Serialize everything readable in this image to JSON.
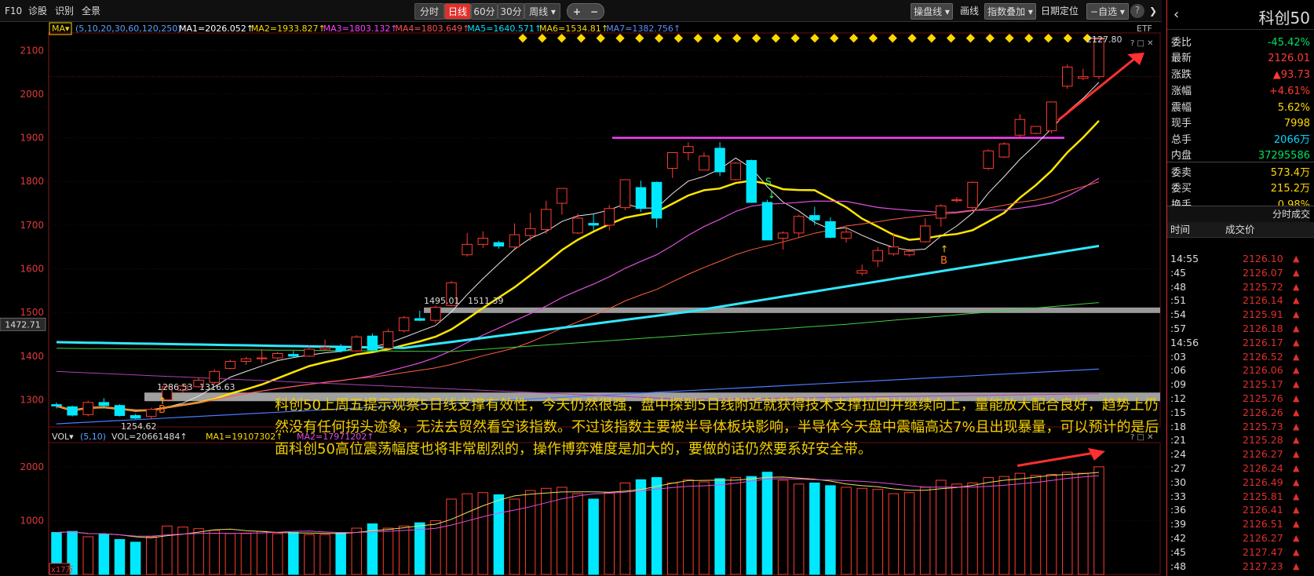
{
  "toolbar": {
    "left_tabs": [
      "F10",
      "诊股",
      "识别",
      "全景"
    ],
    "period_tabs": [
      {
        "label": "分时",
        "active": false
      },
      {
        "label": "日线",
        "active": true
      },
      {
        "label": "60分",
        "active": false
      },
      {
        "label": "30分",
        "active": false
      },
      {
        "label": "周线 ▾",
        "active": false
      }
    ],
    "zoom_in": "+",
    "zoom_out": "−",
    "right_tools": [
      {
        "label": "操盘线",
        "dropdown": true
      },
      {
        "label": "画线",
        "dropdown": false
      },
      {
        "label": "指数叠加",
        "dropdown": true
      },
      {
        "label": "日期定位",
        "dropdown": false
      },
      {
        "label": "−自选",
        "dropdown": true
      }
    ],
    "help": "?"
  },
  "ma_legend": {
    "tag": "MA▾",
    "params": "(5,10,20,30,60,120,250)",
    "items": [
      {
        "text": "MA1=2026.052↑",
        "color": "#ffffff"
      },
      {
        "text": "MA2=1933.827↑",
        "color": "#ffd700"
      },
      {
        "text": "MA3=1803.132↑",
        "color": "#ff40ff"
      },
      {
        "text": "MA4=1803.649↑",
        "color": "#ff5050"
      },
      {
        "text": "MA5=1640.571↑",
        "color": "#00e0ff"
      },
      {
        "text": "MA6=1534.81↑",
        "color": "#ffd700"
      },
      {
        "text": "MA7=1382.756↑",
        "color": "#5a8aff"
      }
    ]
  },
  "etf": "ETF",
  "price_axis": [
    "2100",
    "2000",
    "1900",
    "1800",
    "1700",
    "1600",
    "1500",
    "1400",
    "1300"
  ],
  "current_price_tag": "1472.71",
  "annotations": {
    "high": "2127.80",
    "level1a": "1495.01",
    "level1b": "1511.39",
    "level2a": "1286.53",
    "level2b": "1316.63",
    "low": "1254.62",
    "s_mark": "S",
    "b_mark1": "B",
    "b_mark2": "B"
  },
  "vol_legend": {
    "tag": "VOL▾",
    "params": "(5,10)",
    "vol": "VOL=20661484↑",
    "ma1": "MA1=19107302↑",
    "ma2": "MA2=17971202↑"
  },
  "vol_axis": [
    "2000",
    "1000"
  ],
  "vol_unit": "x17万",
  "caption": "科创50上周五提示观察5日线支撑有效性，今天仍然很强，盘中探到5日线附近就获得技术支撑拉回并继续向上，量能放大配合良好，趋势上仍然没有任何拐头迹象，无法去贸然看空该指数。不过该指数主要被半导体板块影响，半导体今天盘中震幅高达7%且出现暴量，可以预计的是后面科创50高位震荡幅度也将非常剧烈的，操作博弈难度是加大的，要做的话仍然要系好安全带。",
  "right_panel": {
    "title": "科创50",
    "quotes": [
      {
        "label": "委比",
        "value": "-45.42%",
        "color": "#00e060"
      },
      {
        "label": "最新",
        "value": "2126.01",
        "color": "#ff3b30"
      },
      {
        "label": "涨跌",
        "value": "▲93.73",
        "color": "#ff3b30"
      },
      {
        "label": "涨幅",
        "value": "+4.61%",
        "color": "#ff3b30"
      },
      {
        "label": "震幅",
        "value": "5.62%",
        "color": "#ffd700"
      },
      {
        "label": "现手",
        "value": "7998",
        "color": "#ffd700"
      },
      {
        "label": "总手",
        "value": "2066万",
        "color": "#00d8ff"
      },
      {
        "label": "内盘",
        "value": "37295586",
        "color": "#00e060"
      },
      {
        "label": "委卖",
        "value": "573.4万",
        "color": "#ffd700"
      },
      {
        "label": "委买",
        "value": "215.2万",
        "color": "#ffd700"
      },
      {
        "label": "换手",
        "value": "0.98%",
        "color": "#ffd700"
      }
    ],
    "ticks_title": "分时成交",
    "col_time": "时间",
    "col_price": "成交价",
    "ticks": [
      {
        "t": "14:55",
        "p": "2126.10"
      },
      {
        "t": ":45",
        "p": "2126.07"
      },
      {
        "t": ":48",
        "p": "2125.72"
      },
      {
        "t": ":51",
        "p": "2126.14"
      },
      {
        "t": ":54",
        "p": "2125.91"
      },
      {
        "t": ":57",
        "p": "2126.18"
      },
      {
        "t": "14:56",
        "p": "2126.17"
      },
      {
        "t": ":03",
        "p": "2126.52"
      },
      {
        "t": ":06",
        "p": "2126.06"
      },
      {
        "t": ":09",
        "p": "2125.17"
      },
      {
        "t": ":12",
        "p": "2125.76"
      },
      {
        "t": ":15",
        "p": "2126.26"
      },
      {
        "t": ":18",
        "p": "2125.73"
      },
      {
        "t": ":21",
        "p": "2125.28"
      },
      {
        "t": ":24",
        "p": "2126.27"
      },
      {
        "t": ":27",
        "p": "2126.24"
      },
      {
        "t": ":30",
        "p": "2126.49"
      },
      {
        "t": ":33",
        "p": "2125.81"
      },
      {
        "t": ":36",
        "p": "2126.41"
      },
      {
        "t": ":39",
        "p": "2126.51"
      },
      {
        "t": ":42",
        "p": "2126.27"
      },
      {
        "t": ":45",
        "p": "2127.47"
      },
      {
        "t": ":48",
        "p": "2127.23"
      }
    ]
  },
  "colors": {
    "up": "#ff3b30",
    "down": "#00e8ff",
    "bg": "#000000",
    "grid": "#3a1010"
  },
  "chart_data": {
    "type": "candlestick",
    "candles": [
      [
        1289,
        1294,
        1280,
        1286
      ],
      [
        1284,
        1287,
        1262,
        1265
      ],
      [
        1266,
        1298,
        1262,
        1294
      ],
      [
        1294,
        1304,
        1280,
        1287
      ],
      [
        1287,
        1290,
        1262,
        1264
      ],
      [
        1264,
        1268,
        1256,
        1258
      ],
      [
        1262,
        1282,
        1256,
        1278
      ],
      [
        1300,
        1334,
        1298,
        1330
      ],
      [
        1322,
        1336,
        1316,
        1332
      ],
      [
        1330,
        1350,
        1328,
        1345
      ],
      [
        1340,
        1370,
        1336,
        1365
      ],
      [
        1372,
        1392,
        1370,
        1388
      ],
      [
        1388,
        1398,
        1380,
        1394
      ],
      [
        1394,
        1416,
        1384,
        1396
      ],
      [
        1396,
        1410,
        1390,
        1406
      ],
      [
        1404,
        1412,
        1396,
        1400
      ],
      [
        1400,
        1424,
        1398,
        1416
      ],
      [
        1416,
        1438,
        1412,
        1420
      ],
      [
        1420,
        1428,
        1408,
        1412
      ],
      [
        1412,
        1448,
        1410,
        1444
      ],
      [
        1446,
        1452,
        1410,
        1414
      ],
      [
        1418,
        1462,
        1416,
        1456
      ],
      [
        1458,
        1492,
        1454,
        1488
      ],
      [
        1486,
        1504,
        1480,
        1482
      ],
      [
        1482,
        1516,
        1476,
        1512
      ],
      [
        1516,
        1572,
        1514,
        1568
      ],
      [
        1632,
        1682,
        1628,
        1656
      ],
      [
        1656,
        1686,
        1648,
        1670
      ],
      [
        1660,
        1664,
        1646,
        1652
      ],
      [
        1650,
        1704,
        1646,
        1678
      ],
      [
        1676,
        1728,
        1664,
        1692
      ],
      [
        1690,
        1756,
        1680,
        1736
      ],
      [
        1750,
        1782,
        1724,
        1784
      ],
      [
        1682,
        1726,
        1680,
        1716
      ],
      [
        1704,
        1726,
        1688,
        1700
      ],
      [
        1700,
        1746,
        1688,
        1738
      ],
      [
        1740,
        1804,
        1734,
        1804
      ],
      [
        1786,
        1802,
        1730,
        1738
      ],
      [
        1798,
        1800,
        1694,
        1716
      ],
      [
        1830,
        1866,
        1808,
        1866
      ],
      [
        1866,
        1890,
        1848,
        1880
      ],
      [
        1826,
        1866,
        1826,
        1858
      ],
      [
        1876,
        1890,
        1812,
        1822
      ],
      [
        1804,
        1844,
        1802,
        1842
      ],
      [
        1848,
        1850,
        1752,
        1752
      ],
      [
        1752,
        1758,
        1666,
        1666
      ],
      [
        1670,
        1686,
        1644,
        1682
      ],
      [
        1682,
        1724,
        1672,
        1720
      ],
      [
        1722,
        1742,
        1700,
        1712
      ],
      [
        1708,
        1718,
        1670,
        1672
      ],
      [
        1670,
        1694,
        1660,
        1684
      ],
      [
        1590,
        1610,
        1584,
        1596
      ],
      [
        1618,
        1650,
        1604,
        1642
      ],
      [
        1634,
        1682,
        1630,
        1650
      ],
      [
        1632,
        1646,
        1628,
        1640
      ],
      [
        1662,
        1716,
        1660,
        1698
      ],
      [
        1716,
        1748,
        1696,
        1744
      ],
      [
        1756,
        1764,
        1752,
        1758
      ],
      [
        1740,
        1800,
        1736,
        1798
      ],
      [
        1830,
        1874,
        1826,
        1870
      ],
      [
        1856,
        1890,
        1854,
        1886
      ],
      [
        1906,
        1954,
        1900,
        1942
      ],
      [
        1910,
        1926,
        1908,
        1926
      ],
      [
        1916,
        1982,
        1910,
        1982
      ],
      [
        2018,
        2068,
        2012,
        2062
      ],
      [
        2036,
        2058,
        2032,
        2040
      ],
      [
        2040,
        2128,
        2034,
        2126
      ]
    ],
    "volume": [
      780,
      800,
      700,
      750,
      650,
      600,
      700,
      900,
      880,
      850,
      820,
      760,
      760,
      800,
      760,
      780,
      740,
      740,
      780,
      860,
      940,
      860,
      900,
      960,
      1000,
      1400,
      1500,
      1520,
      1480,
      1400,
      1560,
      1600,
      1620,
      1500,
      1400,
      1520,
      1700,
      1760,
      1800,
      1700,
      1760,
      1720,
      1780,
      1800,
      1820,
      1900,
      1750,
      1680,
      1700,
      1650,
      1620,
      1600,
      1580,
      1500,
      1520,
      1620,
      1750,
      1680,
      1700,
      1800,
      1820,
      1880,
      1840,
      1860,
      1900,
      1880,
      2000
    ],
    "ylim": [
      1238,
      2140
    ],
    "vol_ylim": [
      0,
      2450
    ]
  }
}
